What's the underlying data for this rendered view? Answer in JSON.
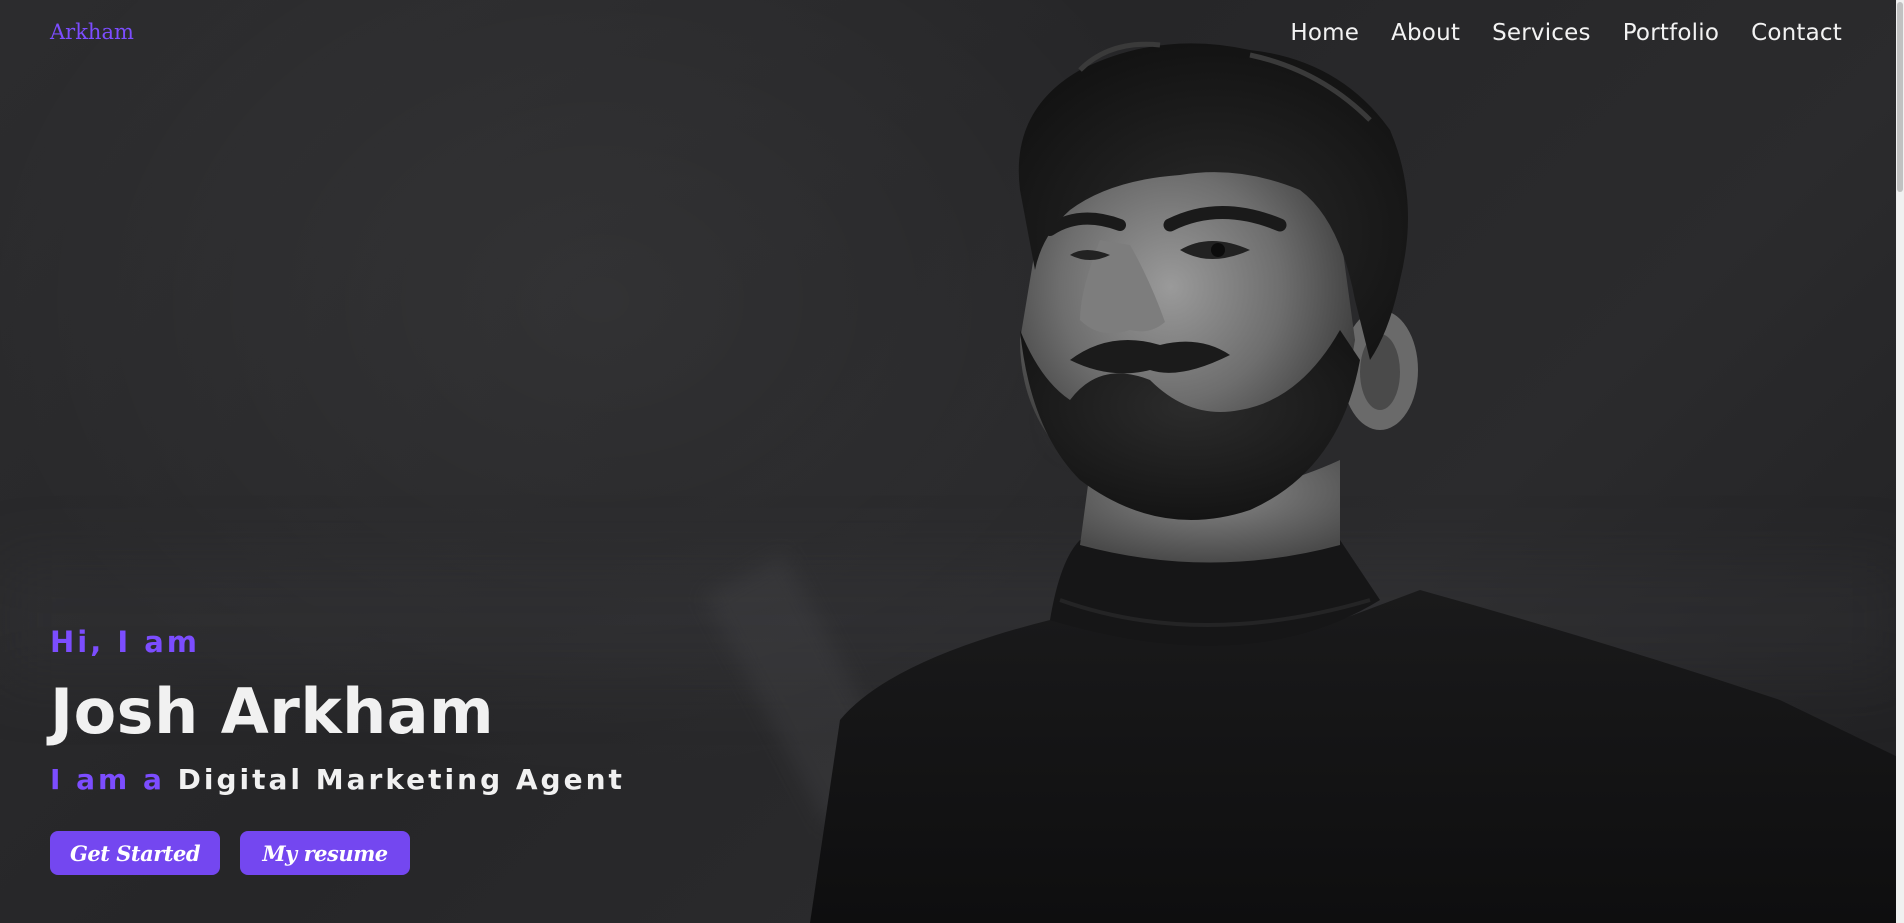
{
  "nav": {
    "logo": "Arkham",
    "items": [
      {
        "label": "Home"
      },
      {
        "label": "About"
      },
      {
        "label": "Services"
      },
      {
        "label": "Portfolio"
      },
      {
        "label": "Contact"
      }
    ]
  },
  "hero": {
    "greeting": "Hi, I am",
    "name": "Josh Arkham",
    "role_prefix": "I am a ",
    "role": "Digital Marketing Agent",
    "buttons": {
      "primary": "Get Started",
      "secondary": "My resume"
    }
  },
  "colors": {
    "accent": "#7c4dff",
    "button": "#7447f0",
    "background": "#2a2a2c",
    "text": "#f1f1f1"
  }
}
